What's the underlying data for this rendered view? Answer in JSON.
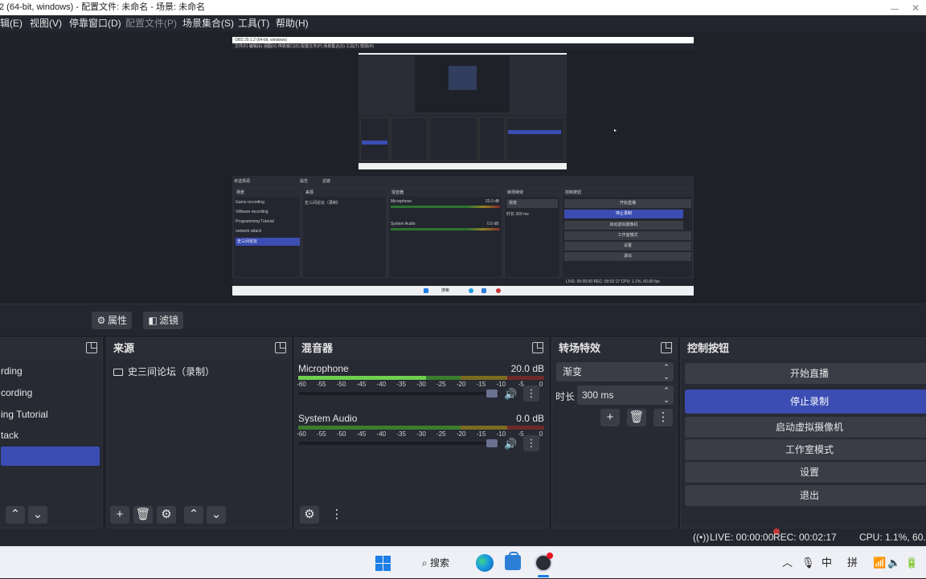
{
  "window": {
    "title": "2 (64-bit, windows) - 配置文件: 未命名 - 场景: 未命名"
  },
  "menu": {
    "edit": "辑(E)",
    "view": "视图(V)",
    "docks": "停靠窗口(D)",
    "profile": "配置文件(P)",
    "scene_collection": "场景集合(S)",
    "tools": "工具(T)",
    "help": "帮助(H)"
  },
  "toolbar": {
    "properties": "属性",
    "filters": "滤镜"
  },
  "scenes": {
    "items": [
      "rding",
      "cording",
      "ing Tutorial",
      "tack",
      ""
    ],
    "selected_index": 4
  },
  "sources": {
    "title": "来源",
    "items": [
      {
        "name": "史三间论坛（录制）",
        "visible": true,
        "locked": false
      }
    ]
  },
  "mixer": {
    "title": "混音器",
    "channels": [
      {
        "name": "Microphone",
        "db": "20.0 dB",
        "level": 0.52,
        "fader": 0.98
      },
      {
        "name": "System Audio",
        "db": "0.0 dB",
        "level": 0.0,
        "fader": 0.98
      }
    ],
    "ticks": [
      "-60",
      "-55",
      "-50",
      "-45",
      "-40",
      "-35",
      "-30",
      "-25",
      "-20",
      "-15",
      "-10",
      "-5",
      "0"
    ]
  },
  "transitions": {
    "title": "转场特效",
    "selected": "渐变",
    "duration_label": "时长",
    "duration_value": "300 ms"
  },
  "controls": {
    "title": "控制按钮",
    "start_stream": "开始直播",
    "stop_recording": "停止录制",
    "virtual_camera": "启动虚拟摄像机",
    "studio_mode": "工作室模式",
    "settings": "设置",
    "exit": "退出"
  },
  "status": {
    "live": "LIVE: 00:00:00",
    "rec": "REC: 00:02:17",
    "cpu": "CPU: 1.1%, 60.00"
  },
  "taskbar": {
    "search": "搜索",
    "ime_mode": "中",
    "ime_pinyin": "拼"
  },
  "preview_capture": {
    "menu_text": "文件(F)   编辑(E)   视图(V)   停靠窗口(D)   配置文件(P)   场景集合(S)   工具(T)   帮助(H)",
    "scenes": [
      "Game recording",
      "VMware recording",
      "Programming Tutorial",
      "network attack",
      "史三间论坛"
    ],
    "selected_scene": 4,
    "source": "史三间论坛（录制）",
    "mic_label": "Microphone",
    "mic_db": "20.0 dB",
    "sys_label": "System Audio",
    "sys_db": "0.0 dB",
    "trans_select": "渐变",
    "trans_dur": "时长  300 ms",
    "ctl_buttons": [
      "开始直播",
      "停止录制",
      "启动虚拟摄像机",
      "工作室模式",
      "设置",
      "退出"
    ],
    "status": "LIVE: 00:00:00   REC: 00:02:17   CPU: 1.1%, 60.00 fps",
    "props": "属性",
    "filters": "滤镜",
    "no_source": "未选择源",
    "search": "搜索"
  }
}
